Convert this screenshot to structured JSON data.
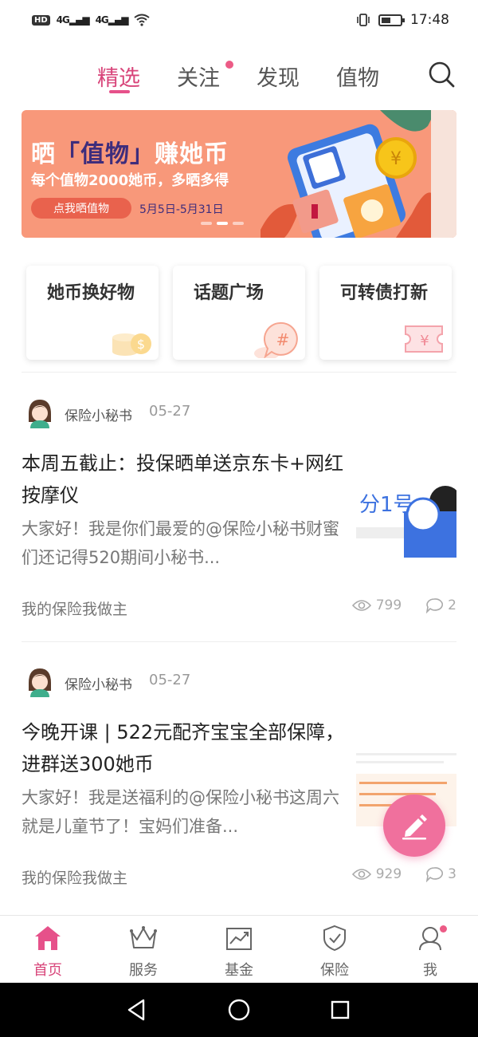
{
  "status_bar": {
    "hd": "HD",
    "signal1": "4G",
    "signal2": "4G",
    "time": "17:48"
  },
  "top_tabs": [
    {
      "label": "精选",
      "active": true
    },
    {
      "label": "关注",
      "has_dot": true
    },
    {
      "label": "发现"
    },
    {
      "label": "值物"
    }
  ],
  "banner": {
    "title_prefix": "晒",
    "title_highlight": "「值物」",
    "title_suffix": "赚她币",
    "subtitle": "每个值物2000她币，多晒多得",
    "button": "点我晒值物",
    "date_range": "5月5日-5月31日"
  },
  "categories": [
    {
      "label": "她币换好物",
      "icon": "coins-icon"
    },
    {
      "label": "话题广场",
      "icon": "hashtag-bubble-icon"
    },
    {
      "label": "可转债打新",
      "icon": "yuan-ticket-icon"
    }
  ],
  "posts": [
    {
      "author": "保险小秘书",
      "date": "05-27",
      "title": "本周五截止：投保晒单送京东卡+网红按摩仪",
      "excerpt": "大家好！我是你们最爱的@保险小秘书财蜜们还记得520期间小秘书...",
      "tag": "我的保险我做主",
      "views": "799",
      "comments": "2",
      "thumb_text": "分1号"
    },
    {
      "author": "保险小秘书",
      "date": "05-27",
      "title": "今晚开课 | 522元配齐宝宝全部保障，进群送300她币",
      "excerpt": "大家好！我是送福利的@保险小秘书这周六就是儿童节了！宝妈们准备...",
      "tag": "我的保险我做主",
      "views": "929",
      "comments": "3"
    }
  ],
  "bottom_nav": [
    {
      "label": "首页",
      "icon": "home-icon",
      "active": true
    },
    {
      "label": "服务",
      "icon": "crown-icon"
    },
    {
      "label": "基金",
      "icon": "chart-icon"
    },
    {
      "label": "保险",
      "icon": "shield-check-icon"
    },
    {
      "label": "我",
      "icon": "user-icon",
      "has_dot": true
    }
  ],
  "colors": {
    "accent": "#d8457a",
    "banner_bg": "#f8987a",
    "fab": "#f0709d"
  }
}
